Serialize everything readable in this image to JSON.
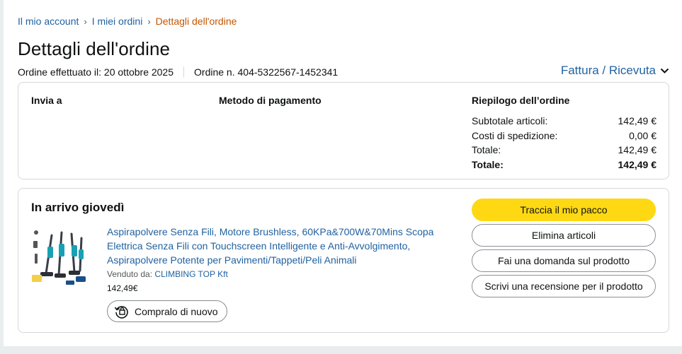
{
  "breadcrumb": {
    "items": [
      "Il mio account",
      "I miei ordini"
    ],
    "current": "Dettagli dell'ordine",
    "separator": "›"
  },
  "page": {
    "title": "Dettagli dell'ordine"
  },
  "order": {
    "placed_label": "Ordine effettuato il: 20 ottobre 2025",
    "number_label": "Ordine n. 404-5322567-1452341"
  },
  "invoice": {
    "label": "Fattura / Ricevuta",
    "icon": "chevron-down-icon"
  },
  "summary": {
    "ship_to_heading": "Invia a",
    "payment_heading": "Metodo di pagamento",
    "order_summary_heading": "Riepilogo dell’ordine",
    "rows": [
      {
        "label": "Subtotale articoli:",
        "value": "142,49 €"
      },
      {
        "label": "Costi di spedizione:",
        "value": "0,00 €"
      },
      {
        "label": "Totale:",
        "value": "142,49 €"
      },
      {
        "label": "Totale:",
        "value": "142,49 €"
      }
    ]
  },
  "shipment": {
    "status": "In arrivo giovedì",
    "product": {
      "title": "Aspirapolvere Senza Fili, Motore Brushless, 60KPa&700W&70Mins Scopa Elettrica Senza Fili con Touchscreen Intelligente e Anti-Avvolgimento, Aspirapolvere Potente per Pavimenti/Tappeti/Peli Animali",
      "sold_by_label": "Venduto da:",
      "seller": "CLIMBING TOP Kft",
      "price": "142,49€",
      "buy_again_label": "Compralo di nuovo"
    },
    "actions": {
      "track": "Traccia il mio pacco",
      "remove": "Elimina articoli",
      "question": "Fai una domanda sul prodotto",
      "review": "Scrivi una recensione per il prodotto"
    }
  },
  "colors": {
    "link": "#2162a1",
    "current_crumb": "#c45500",
    "primary_button": "#ffd814",
    "border": "#d5d9d9",
    "text": "#0f1111",
    "background": "#eaeded"
  }
}
